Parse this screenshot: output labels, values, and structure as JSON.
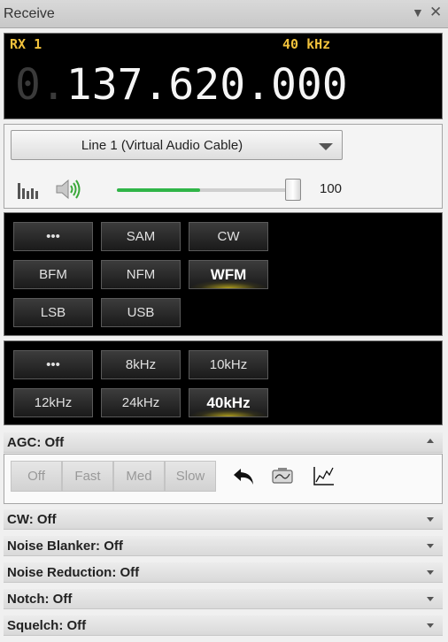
{
  "window": {
    "title": "Receive"
  },
  "receiver": {
    "rx_label": "RX 1",
    "bandwidth_display": "40 kHz",
    "freq_dim": "0.",
    "freq_main": "137.620.000"
  },
  "audio": {
    "device": "Line 1 (Virtual Audio Cable)",
    "volume": 100,
    "volume_text": "100",
    "volume_fraction": 0.45
  },
  "modes": [
    "•••",
    "SAM",
    "CW",
    "BFM",
    "NFM",
    "WFM",
    "LSB",
    "USB"
  ],
  "selected_mode": "WFM",
  "bandwidths": [
    "•••",
    "8kHz",
    "10kHz",
    "12kHz",
    "24kHz",
    "40kHz"
  ],
  "selected_bandwidth": "40kHz",
  "agc": {
    "header": "AGC: Off",
    "buttons": [
      "Off",
      "Fast",
      "Med",
      "Slow"
    ]
  },
  "sections": [
    "CW: Off",
    "Noise Blanker: Off",
    "Noise Reduction: Off",
    "Notch: Off",
    "Squelch: Off"
  ],
  "colors": {
    "accent_yellow": "#f2c23c",
    "volume_green": "#30b548"
  }
}
